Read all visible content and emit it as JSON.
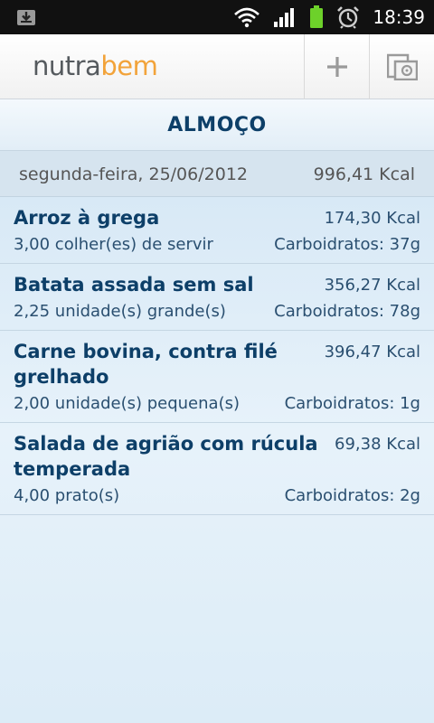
{
  "status_bar": {
    "time": "18:39",
    "icons": [
      "download-icon",
      "wifi-icon",
      "signal-icon",
      "battery-icon",
      "alarm-icon"
    ],
    "colors": {
      "battery": "#6dd12a"
    }
  },
  "app_bar": {
    "logo_part1": "nutra",
    "logo_part2": "bem",
    "add_icon": "plus-icon",
    "settings_icon": "settings-icon",
    "colors": {
      "logo_gray": "#555a5e",
      "logo_orange": "#f2a33a"
    }
  },
  "meal": {
    "title": "ALMOÇO",
    "date": "segunda-feira, 25/06/2012",
    "total_kcal": "996,41 Kcal"
  },
  "foods": [
    {
      "name": "Arroz à grega",
      "kcal": "174,30 Kcal",
      "quantity": "3,00 colher(es) de servir",
      "carbs": "Carboidratos: 37g"
    },
    {
      "name": "Batata assada sem sal",
      "kcal": "356,27 Kcal",
      "quantity": "2,25 unidade(s) grande(s)",
      "carbs": "Carboidratos: 78g"
    },
    {
      "name": "Carne bovina, contra filé grelhado",
      "kcal": "396,47 Kcal",
      "quantity": "2,00 unidade(s) pequena(s)",
      "carbs": "Carboidratos: 1g"
    },
    {
      "name": "Salada de agrião com rúcula temperada",
      "kcal": "69,38 Kcal",
      "quantity": "4,00 prato(s)",
      "carbs": "Carboidratos: 2g"
    }
  ],
  "colors": {
    "title_blue": "#0d3f68",
    "background": "#e3f0f9"
  }
}
